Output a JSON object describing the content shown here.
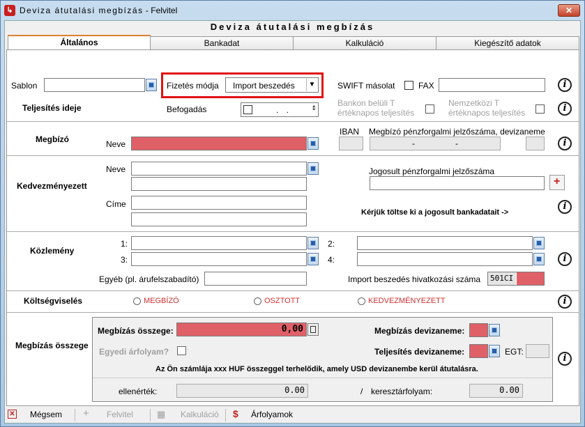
{
  "window": {
    "title_spaced": "Deviza átutalási megbízás",
    "title_rest": " - Felvitel",
    "close_glyph": "✕"
  },
  "header": {
    "title": "Deviza átutalási megbízás"
  },
  "tabs": [
    {
      "label": "Általános",
      "active": true
    },
    {
      "label": "Bankadat"
    },
    {
      "label": "Kalkuláció"
    },
    {
      "label": "Kiegészítő adatok"
    }
  ],
  "general": {
    "sablon_label": "Sablon",
    "fizetes_label": "Fizetés módja",
    "fizetes_value": "Import beszedés",
    "swift_label": "SWIFT másolat",
    "fax_label": "FAX",
    "teljesites_label": "Teljesítés ideje",
    "befogadas_label": "Befogadás",
    "date_value": ".   .",
    "bankon_beluli": "Bankon belüli T értéknapos teljesítés",
    "nemzetkozi": "Nemzetközi T értéknapos teljesítés"
  },
  "megbizo": {
    "section": "Megbízó",
    "neve_label": "Neve",
    "iban_label": "IBAN",
    "account_label": "Megbízó pénzforgalmi jelzőszáma, devizaneme",
    "dash1": "-",
    "dash2": "-"
  },
  "kedvezmenyezett": {
    "section": "Kedvezményezett",
    "neve_label": "Neve",
    "cime_label": "Címe",
    "jogosult_label": "Jogosult pénzforgalmi jelzőszáma",
    "notice": "Kérjük töltse ki a jogosult bankadatait ->"
  },
  "kozlemeny": {
    "section": "Közlemény",
    "l1": "1:",
    "l2": "2:",
    "l3": "3:",
    "l4": "4:",
    "egyeb_label": "Egyéb (pl. árufelszabadító)",
    "import_ref_label": "Import beszedés hivatkozási száma",
    "import_ref_prefix": "501CI"
  },
  "koltseg": {
    "section": "Költségviselés",
    "opt1": "MEGBÍZÓ",
    "opt2": "OSZTOTT",
    "opt3": "KEDVEZMÉNYEZETT"
  },
  "osszeg": {
    "section": "Megbízás összege",
    "osszeg_label": "Megbízás összege:",
    "osszeg_value": "0,00",
    "devizanem_label": "Megbízás devizaneme:",
    "egyedi_label": "Egyedi árfolyam?",
    "telj_devizanem_label": "Teljesítés devizaneme:",
    "egt_label": "EGT:",
    "notice": "Az Ön számlája xxx HUF összeggel terhelődik, amely USD devizanembe kerül átutalásra.",
    "ellenertek_label": "ellenérték:",
    "ellenertek_value": "0.00",
    "slash": "/",
    "kereszt_label": "keresztárfolyam:",
    "kereszt_value": "0.00"
  },
  "bottom": {
    "megsem": "Mégsem",
    "felvitel": "Felvitel",
    "kalkulacio": "Kalkuláció",
    "arfolyamok": "Árfolyamok"
  },
  "colors": {
    "required": "#e06068",
    "highlight": "#e01010"
  }
}
